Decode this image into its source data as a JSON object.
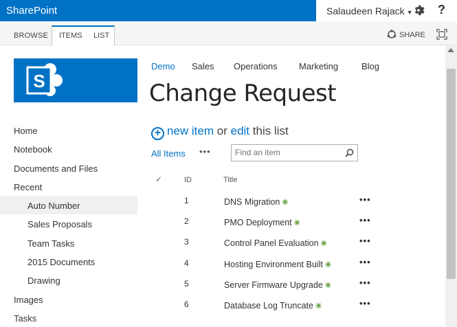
{
  "suite": {
    "brand": "SharePoint",
    "user": "Salaudeen Rajack",
    "help": "?"
  },
  "ribbon": {
    "browse": "BROWSE",
    "items": "ITEMS",
    "list": "LIST",
    "share": "SHARE"
  },
  "colors": {
    "accent": "#0072c6",
    "new_badge": "#5b9b37"
  },
  "topnav": [
    "Demo",
    "Sales",
    "Operations",
    "Marketing",
    "Blog"
  ],
  "page": {
    "title": "Change Request"
  },
  "quicklaunch": [
    "Home",
    "Notebook",
    "Documents and Files",
    "Recent",
    "Auto Number",
    "Sales Proposals",
    "Team Tasks",
    "2015 Documents",
    "Drawing",
    "Images",
    "Tasks"
  ],
  "list": {
    "new_item": "new item",
    "or": "or",
    "edit": "edit",
    "this_list": "this list",
    "view": "All Items",
    "more": "•••",
    "search_placeholder": "Find an item",
    "col_check": "✓",
    "col_id": "ID",
    "col_title": "Title",
    "rows": [
      {
        "id": "1",
        "title": "DNS Migration"
      },
      {
        "id": "2",
        "title": "PMO Deployment"
      },
      {
        "id": "3",
        "title": "Control Panel Evaluation"
      },
      {
        "id": "4",
        "title": "Hosting Environment Built"
      },
      {
        "id": "5",
        "title": "Server Firmware Upgrade"
      },
      {
        "id": "6",
        "title": "Database Log Truncate"
      }
    ],
    "row_menu": "•••",
    "new_marker": "✳"
  }
}
